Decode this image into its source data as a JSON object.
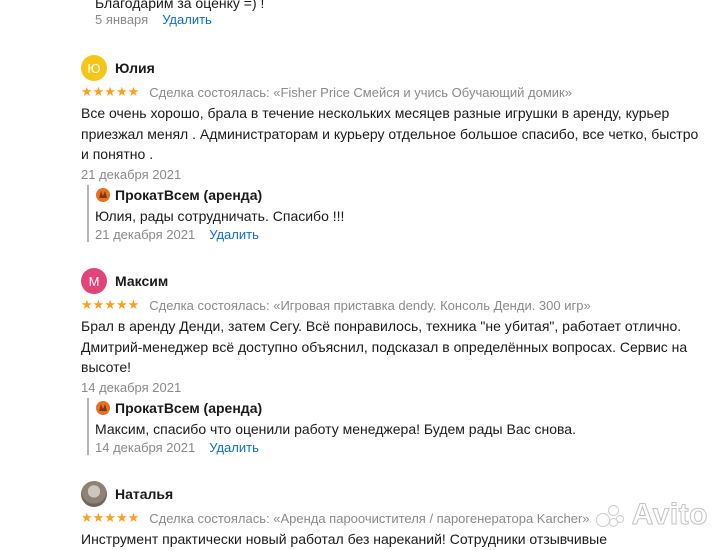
{
  "top_reply": {
    "text": "Благодарим за оценку =) !",
    "date": "5 января",
    "delete_label": "Удалить"
  },
  "stars_glyphs": "★★★★★",
  "reviews": [
    {
      "avatar_letter": "Ю",
      "avatar_color": "#f5c518",
      "name": "Юлия",
      "deal": "Сделка состоялась: «Fisher Price Смейся и учись Обучающий домик»",
      "text": "Все очень хорошо, брала в течение нескольких месяцев разные игрушки в аренду, курьер приезжал менял . Администраторам и курьеру отдельное большое спасибо, все четко, быстро и понятно .",
      "date": "21 декабря 2021",
      "reply": {
        "shop": "ПрокатВсем (аренда)",
        "text": "Юлия, рады сотрудничать. Спасибо !!!",
        "date": "21 декабря 2021",
        "delete_label": "Удалить"
      }
    },
    {
      "avatar_letter": "М",
      "avatar_color": "#e2447a",
      "name": "Максим",
      "deal": "Сделка состоялась: «Игровая приставка dendy. Консоль Денди. 300 игр»",
      "text": "Брал в аренду Денди, затем Сегу. Всё понравилось, техника \"не убитая\", работает отлично. Дмитрий-менеджер всё доступно объяснил, подсказал в определённых вопросах. Сервис на высоте!",
      "date": "14 декабря 2021",
      "reply": {
        "shop": "ПрокатВсем (аренда)",
        "text": "Максим, спасибо что оценили работу менеджера! Будем рады Вас снова.",
        "date": "14 декабря 2021",
        "delete_label": "Удалить"
      }
    },
    {
      "name": "Наталья",
      "deal": "Сделка состоялась: «Аренда пароочистителя / парогенератора Karcher»",
      "text": "Инструмент практически новый работал без нареканий! Сотрудники отзывчивые"
    }
  ],
  "watermark": "Avito"
}
